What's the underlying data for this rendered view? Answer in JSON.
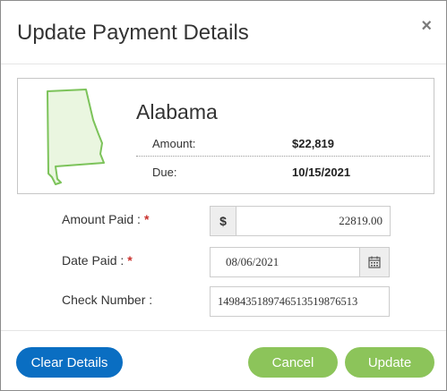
{
  "dialog": {
    "title": "Update Payment Details",
    "close_symbol": "×"
  },
  "summary": {
    "state_name": "Alabama",
    "state_icon": "alabama-map-icon",
    "rows": [
      {
        "label": "Amount:",
        "value": "$22,819"
      },
      {
        "label": "Due:",
        "value": "10/15/2021"
      }
    ]
  },
  "form": {
    "amount_paid": {
      "label": "Amount Paid :",
      "required_mark": "*",
      "currency_symbol": "$",
      "value": "22819.00"
    },
    "date_paid": {
      "label": "Date Paid :",
      "required_mark": "*",
      "value": "08/06/2021",
      "icon": "calendar-icon"
    },
    "check_number": {
      "label": "Check Number :",
      "value": "14984351897465135198765​13"
    }
  },
  "buttons": {
    "clear": "Clear Details",
    "cancel": "Cancel",
    "update": "Update"
  },
  "colors": {
    "primary": "#0a6ec2",
    "success": "#8cc45a",
    "required": "#c9302c",
    "map_fill": "#eaf6e0",
    "map_stroke": "#7cc35a"
  }
}
